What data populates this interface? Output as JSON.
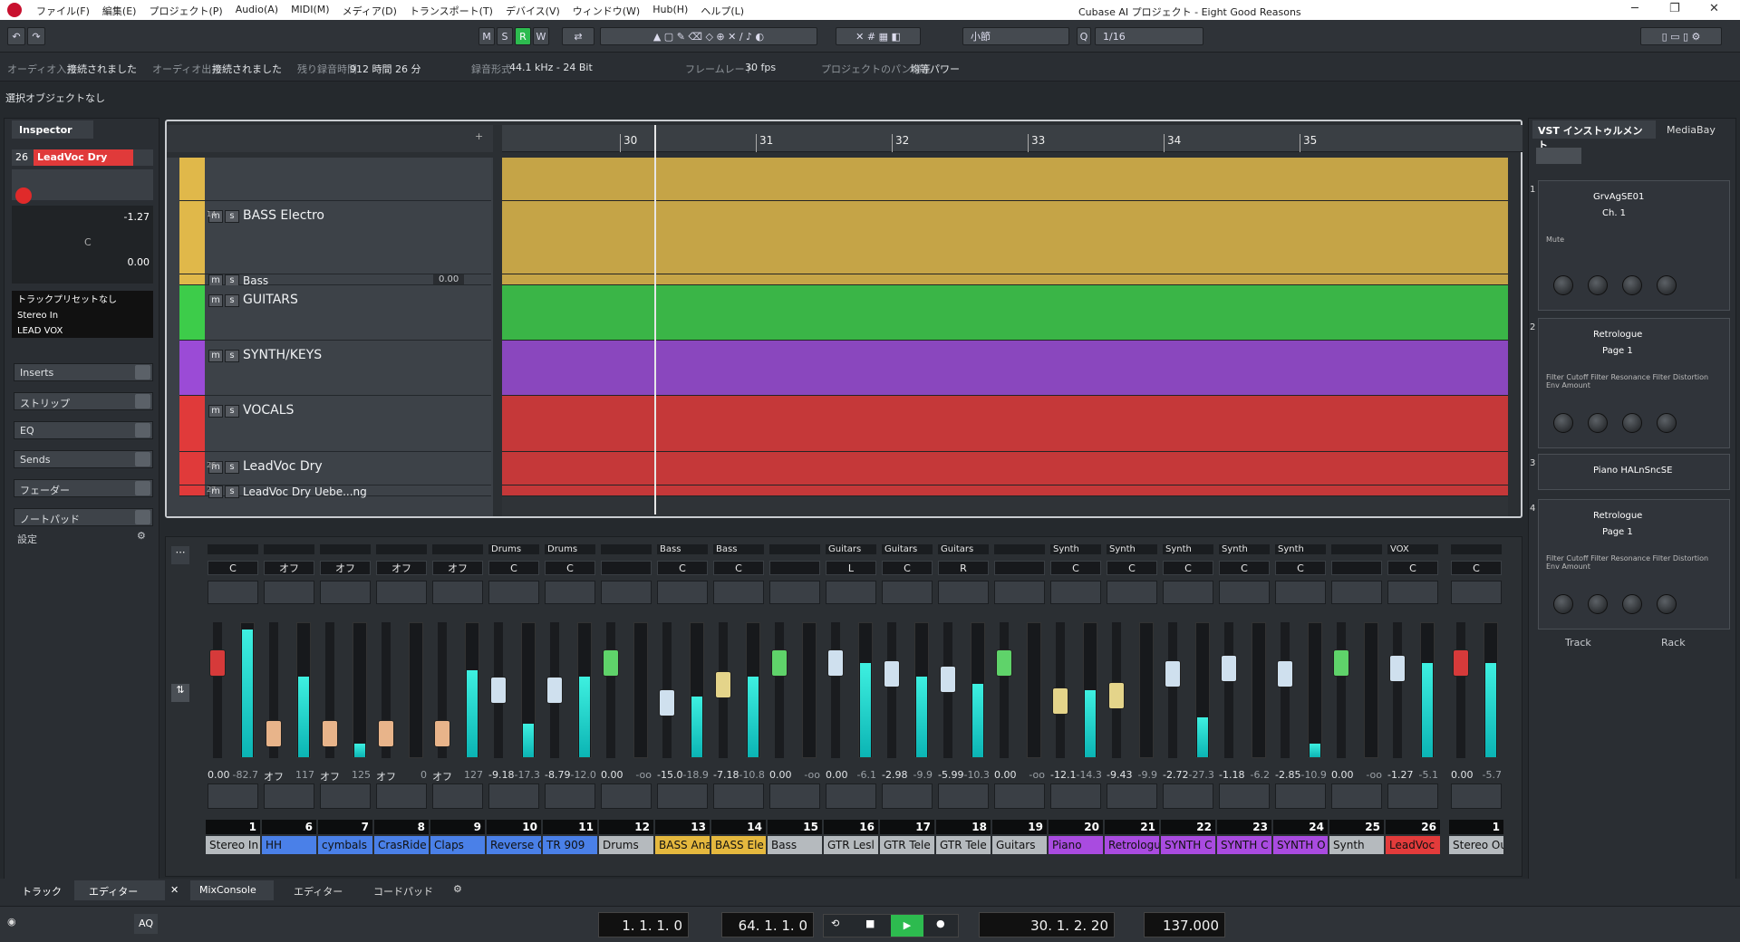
{
  "window": {
    "title": "Cubase AI プロジェクト - Eight Good Reasons"
  },
  "menu": [
    "ファイル(F)",
    "編集(E)",
    "プロジェクト(P)",
    "Audio(A)",
    "MIDI(M)",
    "メディア(D)",
    "トランスポート(T)",
    "デバイス(V)",
    "ウィンドウ(W)",
    "Hub(H)",
    "ヘルプ(L)"
  ],
  "toolbar": {
    "m": "M",
    "s": "S",
    "r": "R",
    "w": "W",
    "grid": "小節",
    "quant": "1/16",
    "q": "Q"
  },
  "info": [
    {
      "k": "オーディオ入力",
      "v": "接続されました"
    },
    {
      "k": "オーディオ出力",
      "v": "接続されました"
    },
    {
      "k": "残り録音時間",
      "v": "912 時間 26 分"
    },
    {
      "k": "録音形式",
      "v": "44.1 kHz - 24 Bit"
    },
    {
      "k": "フレームレート",
      "v": "30 fps"
    },
    {
      "k": "プロジェクトのパン補正",
      "v": "均等パワー"
    }
  ],
  "selection": "選択オブジェクトなし",
  "inspector": {
    "tab": "Inspector",
    "track_num": "26",
    "track_name": "LeadVoc Dry",
    "volume": "-1.27",
    "pan": "C",
    "pan_val": "0.00",
    "preset": "トラックプリセットなし",
    "input": "Stereo In",
    "output": "LEAD VOX",
    "sections": [
      "Inserts",
      "ストリップ",
      "EQ",
      "Sends",
      "フェーダー",
      "ノートパッド"
    ],
    "settings": "設定"
  },
  "tracks": [
    {
      "name": "",
      "color": "#e0b84a",
      "h": 48
    },
    {
      "name": "BASS Electro",
      "color": "#e0b84a",
      "h": 82,
      "num": "14"
    },
    {
      "name": "Bass",
      "color": "#e0b84a",
      "h": 12,
      "val": "0.00"
    },
    {
      "name": "GUITARS",
      "color": "#3dcc4a",
      "h": 62
    },
    {
      "name": "SYNTH/KEYS",
      "color": "#9b4bd6",
      "h": 62
    },
    {
      "name": "VOCALS",
      "color": "#e03a3a",
      "h": 62
    },
    {
      "name": "LeadVoc Dry",
      "color": "#e03a3a",
      "h": 38,
      "num": "26"
    },
    {
      "name": "LeadVoc Dry Uebe...ng",
      "color": "#e03a3a",
      "h": 12,
      "num": "27"
    }
  ],
  "ruler": [
    "30",
    "31",
    "32",
    "33",
    "34",
    "35"
  ],
  "mixer": [
    {
      "tag": "",
      "pan": "C",
      "vol": "0.00",
      "peak": "-82.7",
      "num": "1",
      "lbl": "Stereo In",
      "lc": "#b5babe",
      "cap": "#d63a3a",
      "meter": 0.95,
      "fader": 0.25
    },
    {
      "tag": "",
      "pan": "オフ",
      "vol": "オフ",
      "peak": "117",
      "num": "6",
      "lbl": "HH",
      "lc": "#4a80e8",
      "cap": "#e8b48a",
      "meter": 0.6,
      "fader": 0.9
    },
    {
      "tag": "",
      "pan": "オフ",
      "vol": "オフ",
      "peak": "125",
      "num": "7",
      "lbl": "cymbals",
      "lc": "#4a80e8",
      "cap": "#e8b48a",
      "meter": 0.1,
      "fader": 0.9
    },
    {
      "tag": "",
      "pan": "オフ",
      "vol": "オフ",
      "peak": "0",
      "num": "8",
      "lbl": "CrasRide",
      "lc": "#4a80e8",
      "cap": "#e8b48a",
      "meter": 0.0,
      "fader": 0.9
    },
    {
      "tag": "",
      "pan": "オフ",
      "vol": "オフ",
      "peak": "127",
      "num": "9",
      "lbl": "Claps",
      "lc": "#4a80e8",
      "cap": "#e8b48a",
      "meter": 0.65,
      "fader": 0.9
    },
    {
      "tag": "Drums",
      "pan": "C",
      "vol": "-9.18",
      "peak": "-17.3",
      "num": "10",
      "lbl": "Reverse C",
      "lc": "#4a80e8",
      "cap": "#cfe0ee",
      "meter": 0.25,
      "fader": 0.5
    },
    {
      "tag": "Drums",
      "pan": "C",
      "vol": "-8.79",
      "peak": "-12.0",
      "num": "11",
      "lbl": "TR 909",
      "lc": "#4a80e8",
      "cap": "#cfe0ee",
      "meter": 0.6,
      "fader": 0.5
    },
    {
      "tag": "",
      "pan": "",
      "vol": "0.00",
      "peak": "-oo",
      "num": "12",
      "lbl": "Drums",
      "lc": "#b5babe",
      "cap": "#5fd36a",
      "meter": 0.0,
      "fader": 0.25
    },
    {
      "tag": "Bass",
      "pan": "C",
      "vol": "-15.0",
      "peak": "-18.9",
      "num": "13",
      "lbl": "BASS Ana",
      "lc": "#e5b83e",
      "cap": "#cfe0ee",
      "meter": 0.45,
      "fader": 0.62
    },
    {
      "tag": "Bass",
      "pan": "C",
      "vol": "-7.18",
      "peak": "-10.8",
      "num": "14",
      "lbl": "BASS Ele",
      "lc": "#e5b83e",
      "cap": "#e4d48a",
      "meter": 0.6,
      "fader": 0.45
    },
    {
      "tag": "",
      "pan": "",
      "vol": "0.00",
      "peak": "-oo",
      "num": "15",
      "lbl": "Bass",
      "lc": "#b5babe",
      "cap": "#5fd36a",
      "meter": 0.0,
      "fader": 0.25
    },
    {
      "tag": "Guitars",
      "pan": "L",
      "vol": "0.00",
      "peak": "-6.1",
      "num": "16",
      "lbl": "GTR Lesl",
      "lc": "#b5babe",
      "cap": "#cfe0ee",
      "meter": 0.7,
      "fader": 0.25
    },
    {
      "tag": "Guitars",
      "pan": "C",
      "vol": "-2.98",
      "peak": "-9.9",
      "num": "17",
      "lbl": "GTR Tele",
      "lc": "#b5babe",
      "cap": "#cfe0ee",
      "meter": 0.6,
      "fader": 0.35
    },
    {
      "tag": "Guitars",
      "pan": "R",
      "vol": "-5.99",
      "peak": "-10.3",
      "num": "18",
      "lbl": "GTR Tele",
      "lc": "#b5babe",
      "cap": "#cfe0ee",
      "meter": 0.55,
      "fader": 0.4
    },
    {
      "tag": "",
      "pan": "",
      "vol": "0.00",
      "peak": "-oo",
      "num": "19",
      "lbl": "Guitars",
      "lc": "#b5babe",
      "cap": "#5fd36a",
      "meter": 0.0,
      "fader": 0.25
    },
    {
      "tag": "Synth",
      "pan": "C",
      "vol": "-12.1",
      "peak": "-14.3",
      "num": "20",
      "lbl": "Piano",
      "lc": "#a94be0",
      "cap": "#e4d48a",
      "meter": 0.5,
      "fader": 0.6
    },
    {
      "tag": "Synth",
      "pan": "C",
      "vol": "-9.43",
      "peak": "-9.9",
      "num": "21",
      "lbl": "Retrologu",
      "lc": "#a94be0",
      "cap": "#e4d48a",
      "meter": 0.0,
      "fader": 0.55
    },
    {
      "tag": "Synth",
      "pan": "C",
      "vol": "-2.72",
      "peak": "-27.3",
      "num": "22",
      "lbl": "SYNTH C",
      "lc": "#a94be0",
      "cap": "#cfe0ee",
      "meter": 0.3,
      "fader": 0.35
    },
    {
      "tag": "Synth",
      "pan": "C",
      "vol": "-1.18",
      "peak": "-6.2",
      "num": "23",
      "lbl": "SYNTH C",
      "lc": "#a94be0",
      "cap": "#cfe0ee",
      "meter": 0.0,
      "fader": 0.3
    },
    {
      "tag": "Synth",
      "pan": "C",
      "vol": "-2.85",
      "peak": "-10.9",
      "num": "24",
      "lbl": "SYNTH O",
      "lc": "#a94be0",
      "cap": "#cfe0ee",
      "meter": 0.1,
      "fader": 0.35
    },
    {
      "tag": "",
      "pan": "",
      "vol": "0.00",
      "peak": "-oo",
      "num": "25",
      "lbl": "Synth",
      "lc": "#b5babe",
      "cap": "#5fd36a",
      "meter": 0.0,
      "fader": 0.25
    },
    {
      "tag": "VOX",
      "pan": "C",
      "vol": "-1.27",
      "peak": "-5.1",
      "num": "26",
      "lbl": "LeadVoc",
      "lc": "#e33b3b",
      "cap": "#cfe0ee",
      "meter": 0.7,
      "fader": 0.3
    },
    {
      "tag": "",
      "pan": "C",
      "vol": "0.00",
      "peak": "-5.7",
      "num": "1",
      "lbl": "Stereo Ou",
      "lc": "#b5babe",
      "cap": "#d63a3a",
      "meter": 0.7,
      "fader": 0.25
    }
  ],
  "vst": {
    "tab1": "VST インストゥルメント",
    "tab2": "MediaBay",
    "slots": [
      {
        "n": "1",
        "name": "GrvAgSE01",
        "page": "Ch. 1",
        "sub": "Mute"
      },
      {
        "n": "2",
        "name": "Retrologue",
        "page": "Page 1",
        "sub": "Filter Cutoff  Filter Resonance  Filter Distortion  Env Amount"
      },
      {
        "n": "3",
        "name": "Piano HALnSncSE",
        "page": "",
        "sub": ""
      },
      {
        "n": "4",
        "name": "Retrologue",
        "page": "Page 1",
        "sub": "Filter Cutoff  Filter Resonance  Filter Distortion  Env Amount"
      }
    ],
    "track": "Track",
    "rack": "Rack"
  },
  "bottom_tabs": {
    "left1": "トラック",
    "left2": "エディター",
    "mix": "MixConsole",
    "edit": "エディター",
    "chord": "コードパッド"
  },
  "transport": {
    "left": "1. 1. 1.   0",
    "right": "64. 1. 1.   0",
    "pos": "30. 1. 2. 20",
    "tempo": "137.000",
    "aq": "AQ"
  }
}
